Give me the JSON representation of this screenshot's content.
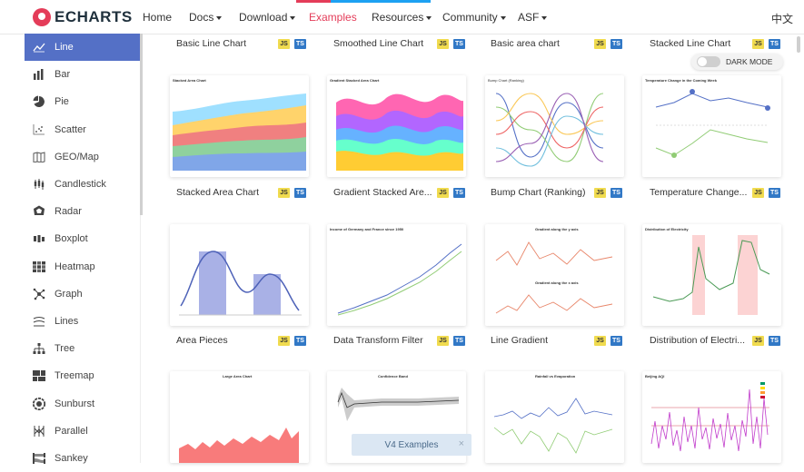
{
  "brand": {
    "name": "ECHARTS"
  },
  "nav": {
    "items": [
      {
        "label": "Home"
      },
      {
        "label": "Docs"
      },
      {
        "label": "Download"
      },
      {
        "label": "Examples"
      },
      {
        "label": "Resources"
      },
      {
        "label": "Community"
      },
      {
        "label": "ASF"
      }
    ],
    "lang": "中文"
  },
  "sidebar": {
    "items": [
      {
        "label": "Line"
      },
      {
        "label": "Bar"
      },
      {
        "label": "Pie"
      },
      {
        "label": "Scatter"
      },
      {
        "label": "GEO/Map"
      },
      {
        "label": "Candlestick"
      },
      {
        "label": "Radar"
      },
      {
        "label": "Boxplot"
      },
      {
        "label": "Heatmap"
      },
      {
        "label": "Graph"
      },
      {
        "label": "Lines"
      },
      {
        "label": "Tree"
      },
      {
        "label": "Treemap"
      },
      {
        "label": "Sunburst"
      },
      {
        "label": "Parallel"
      },
      {
        "label": "Sankey"
      }
    ],
    "active_color": "#5470c6"
  },
  "badges": {
    "js": "JS",
    "ts": "TS"
  },
  "dark_mode": {
    "label": "DARK MODE",
    "on": false
  },
  "top_row": [
    "Basic Line Chart",
    "Smoothed Line Chart",
    "Basic area chart",
    "Stacked Line Chart"
  ],
  "row1": [
    "Stacked Area Chart",
    "Gradient Stacked Are...",
    "Bump Chart (Ranking)",
    "Temperature Change..."
  ],
  "row2": [
    "Area Pieces",
    "Data Transform Filter",
    "Line Gradient",
    "Distribution of Electri..."
  ],
  "thumb_titles": {
    "stacked_area": "Stacked Area Chart",
    "gradient_stacked": "Gradient Stacked Area Chart",
    "bump": "Bump Chart (Ranking)",
    "temperature": "Temperature Change in the Coming Week",
    "income": "Income of Germany and France since 1950",
    "gradient_y": "Gradient along the y axis",
    "gradient_x": "Gradient along the x axis",
    "electricity": "Distribution of Electricity",
    "large_area": "Large Area Chart",
    "confidence": "Confidence Band",
    "rainfall": "Rainfall vs Evaporation",
    "aqi": "Beijing AQI"
  },
  "v4_banner": {
    "label": "V4 Examples",
    "close": "×"
  },
  "colors": {
    "accent": "#e43c59",
    "brand_blue": "#5470c6",
    "js": "#f0db4f",
    "ts": "#3178c6"
  }
}
